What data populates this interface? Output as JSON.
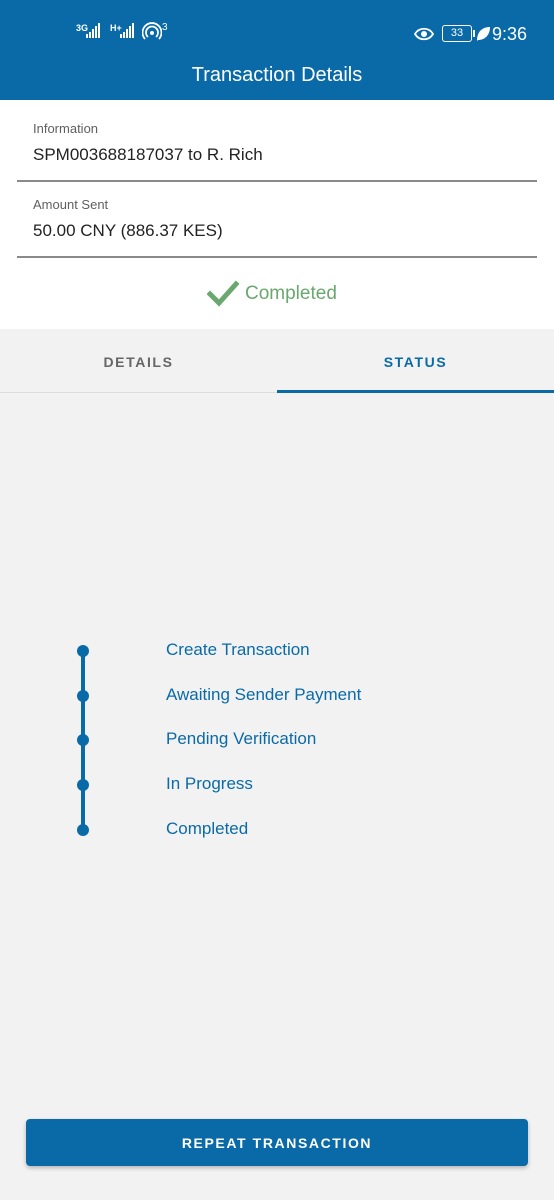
{
  "status_bar": {
    "net1": "3G",
    "net2": "H+",
    "hotspot_count": "3",
    "battery": "33",
    "time": "9:36"
  },
  "header": {
    "title": "Transaction Details"
  },
  "info": {
    "information_label": "Information",
    "information_value": "SPM003688187037 to R. Rich",
    "amount_label": "Amount Sent",
    "amount_value": "50.00 CNY (886.37 KES)",
    "status_text": "Completed",
    "status_color": "#6aa86f"
  },
  "tabs": [
    {
      "label": "DETAILS",
      "active": false
    },
    {
      "label": "STATUS",
      "active": true
    }
  ],
  "timeline": [
    {
      "label": "Create Transaction"
    },
    {
      "label": "Awaiting Sender Payment"
    },
    {
      "label": "Pending Verification"
    },
    {
      "label": "In Progress"
    },
    {
      "label": "Completed"
    }
  ],
  "actions": {
    "repeat_label": "REPEAT TRANSACTION"
  },
  "colors": {
    "accent": "#0a6aa8",
    "background": "#f2f2f2"
  }
}
